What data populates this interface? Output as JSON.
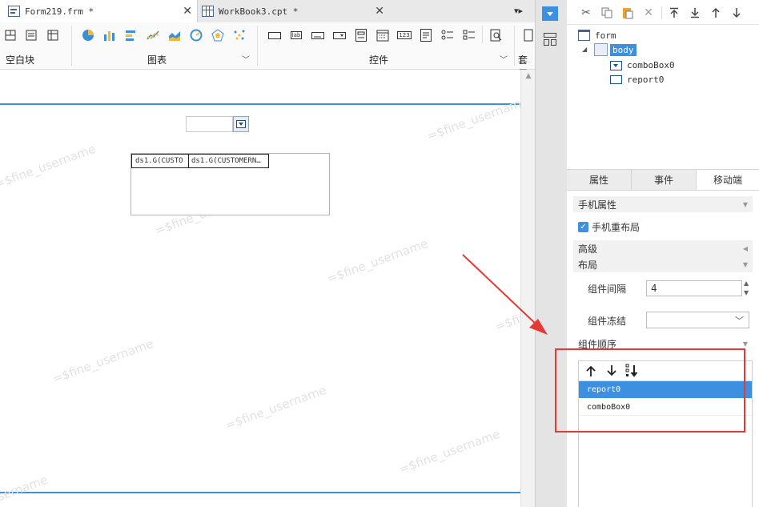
{
  "tabs": [
    {
      "label": "Form219.frm *"
    },
    {
      "label": "WorkBook3.cpt *"
    }
  ],
  "ribbon": {
    "groups": {
      "blank": "空白块",
      "chart": "图表",
      "widget": "控件",
      "nest": "套用"
    },
    "widget_icon_text": {
      "label": "lab",
      "number": "123"
    }
  },
  "canvas": {
    "watermark": "=$fine_username",
    "report_cells": [
      "ds1.G(CUSTO",
      "ds1.G(CUSTOMERN…"
    ]
  },
  "tree": {
    "root": "form",
    "body": "body",
    "children": [
      "comboBox0",
      "report0"
    ]
  },
  "panel_tabs": [
    "属性",
    "事件",
    "移动端"
  ],
  "mobile": {
    "section_phone": "手机属性",
    "relayout_checkbox": {
      "label": "手机重布局",
      "checked": true
    },
    "section_advanced": "高级",
    "section_layout": "布局",
    "spacing": {
      "label": "组件间隔",
      "value": "4"
    },
    "freeze": {
      "label": "组件冻结",
      "value": ""
    },
    "order": {
      "label": "组件顺序",
      "items": [
        "report0",
        "comboBox0"
      ],
      "selected": 0
    }
  },
  "colors": {
    "accent": "#3d8fe0",
    "selected": "#3d8fe0",
    "annotation": "#e53935"
  }
}
